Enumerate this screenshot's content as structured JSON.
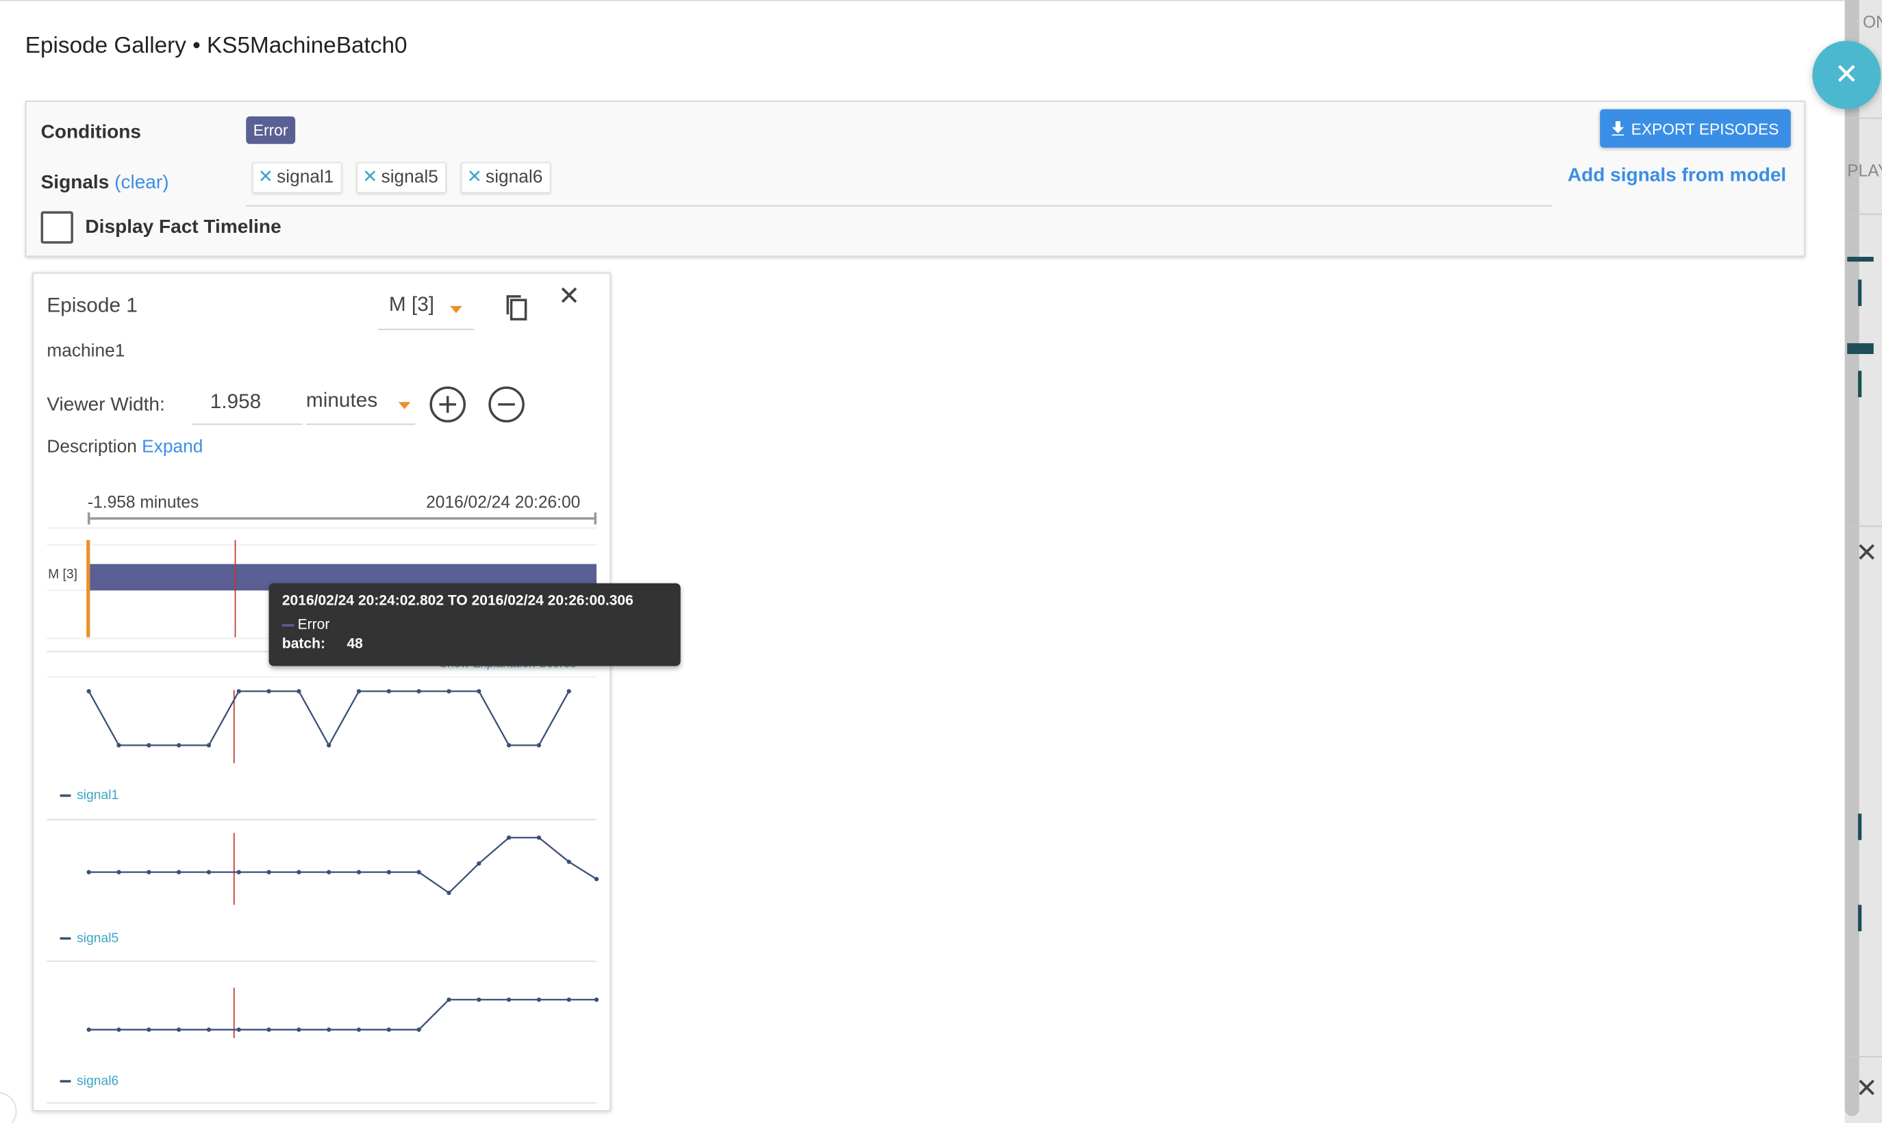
{
  "gallery": {
    "title": "Episode Gallery • KS5MachineBatch0",
    "close_icon": "close-icon"
  },
  "conditions": {
    "label": "Conditions",
    "chips": [
      "Error"
    ],
    "export_label": "EXPORT EPISODES"
  },
  "signals": {
    "label": "Signals",
    "clear_label": "(clear)",
    "chips": [
      "signal1",
      "signal5",
      "signal6"
    ],
    "add_label": "Add signals from model"
  },
  "fact_timeline": {
    "label": "Display Fact Timeline",
    "checked": false
  },
  "episode": {
    "title": "Episode 1",
    "model_value": "M [3]",
    "machine": "machine1",
    "viewer_width_label": "Viewer Width:",
    "viewer_width_value": "1.958",
    "viewer_width_unit": "minutes",
    "description_label": "Description",
    "expand_label": "Expand",
    "timeline_start": "-1.958 minutes",
    "timeline_end": "2016/02/24 20:26:00",
    "track_label": "M [3]",
    "explain_link": "Show Explanation Scores"
  },
  "tooltip": {
    "range": "2016/02/24 20:24:02.802 TO 2016/02/24 20:26:00.306",
    "condition": "Error",
    "batch_label": "batch:",
    "batch_value": "48"
  },
  "colors": {
    "accent": "#3a8ee6",
    "fab": "#4cb8cf",
    "condition_bar": "#5a5f94",
    "marker": "#e8912d",
    "cursor": "#c0392b",
    "series": "#3b4f78"
  },
  "background_page": {
    "text_top": "ON",
    "text_play": "PLAY"
  },
  "chart_data": [
    {
      "type": "line",
      "series": [
        {
          "name": "signal1",
          "values": [
            1,
            0,
            0,
            0,
            0,
            1,
            1,
            1,
            0,
            1,
            1,
            1,
            1,
            1,
            0,
            0,
            1
          ]
        }
      ],
      "x": [
        1,
        2,
        3,
        4,
        5,
        6,
        7,
        8,
        9,
        10,
        11,
        12,
        13,
        14,
        15,
        16,
        17
      ],
      "xlabel": "",
      "ylabel": "",
      "ylim": [
        0,
        1
      ],
      "grid": false,
      "legend": "bottom-left"
    },
    {
      "type": "line",
      "series": [
        {
          "name": "signal5",
          "values": [
            0,
            0,
            0,
            0,
            0,
            0,
            0,
            0,
            0,
            0,
            0,
            0,
            -0.6,
            0.25,
            1,
            1,
            0.3,
            -0.2
          ]
        }
      ],
      "x": [
        1,
        2,
        3,
        4,
        5,
        6,
        7,
        8,
        9,
        10,
        11,
        12,
        13,
        14,
        15,
        16,
        17,
        18
      ],
      "xlabel": "",
      "ylabel": "",
      "ylim": [
        -0.6,
        1
      ],
      "grid": false,
      "legend": "bottom-left"
    },
    {
      "type": "line",
      "series": [
        {
          "name": "signal6",
          "values": [
            0,
            0,
            0,
            0,
            0,
            0,
            0,
            0,
            0,
            0,
            0,
            0,
            1,
            1,
            1,
            1,
            1,
            1
          ]
        }
      ],
      "x": [
        1,
        2,
        3,
        4,
        5,
        6,
        7,
        8,
        9,
        10,
        11,
        12,
        13,
        14,
        15,
        16,
        17,
        18
      ],
      "xlabel": "",
      "ylabel": "",
      "ylim": [
        0,
        1
      ],
      "grid": false,
      "legend": "bottom-left"
    }
  ]
}
